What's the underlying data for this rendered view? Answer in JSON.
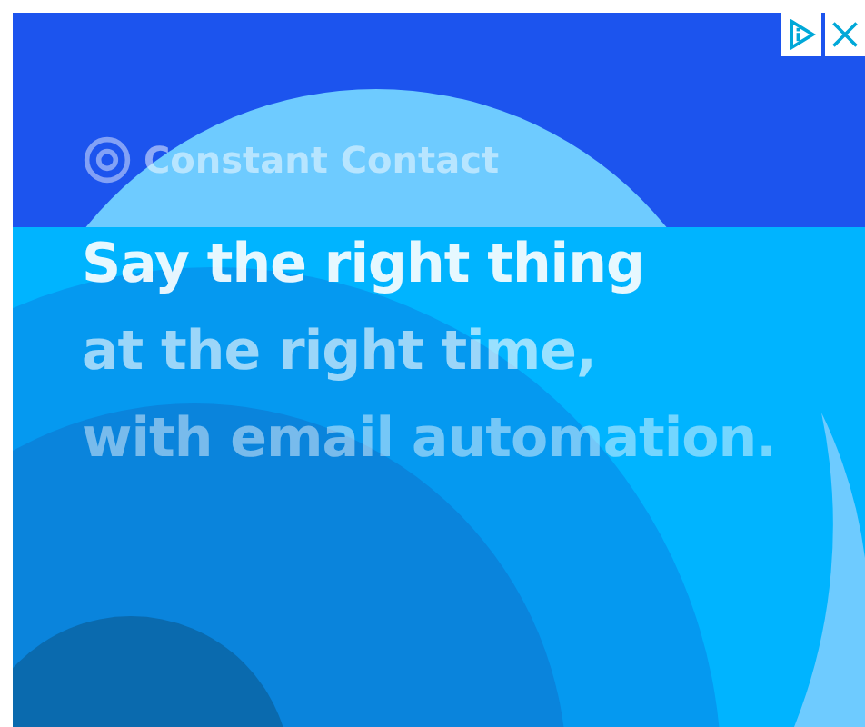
{
  "ad": {
    "logo": "Constant Contact",
    "headline": [
      "Say the right thing",
      "at the right time,",
      "with email automation."
    ],
    "controls": [
      {
        "kind": "adchoices"
      },
      {
        "kind": "close"
      }
    ]
  }
}
